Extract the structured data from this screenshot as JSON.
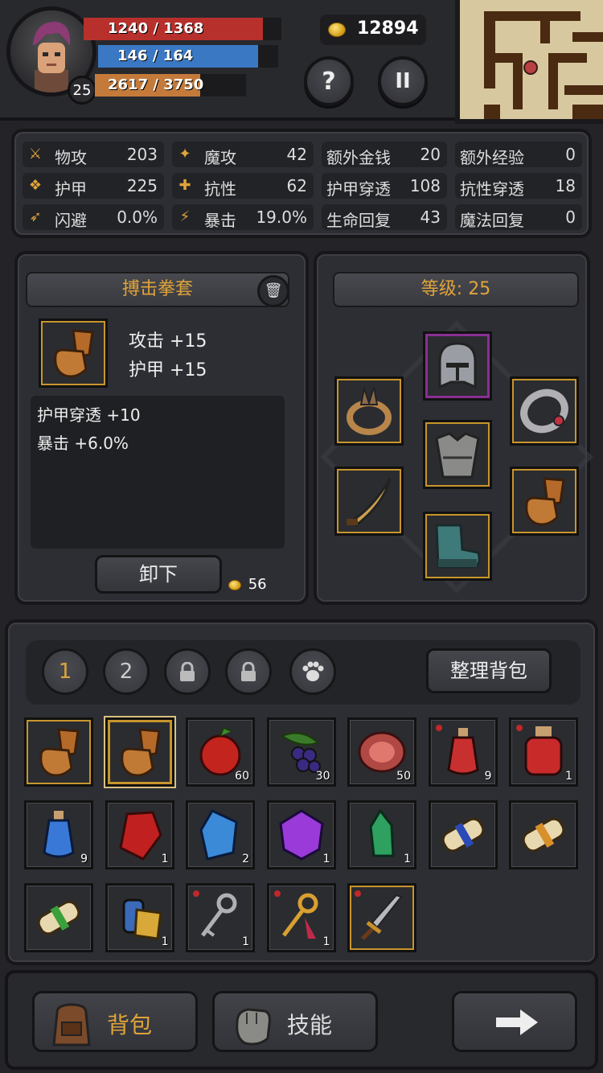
{
  "header": {
    "level": "25",
    "hp_text": "1240 / 1368",
    "hp_fraction": 0.906,
    "mp_text": "146 / 164",
    "mp_fraction": 0.89,
    "exp_text": "2617 / 3750",
    "exp_fraction": 0.698,
    "gold": "12894",
    "help_label": "?",
    "pause_label": "II"
  },
  "stats": [
    {
      "icon": "sword-icon",
      "label": "物攻",
      "value": "203"
    },
    {
      "icon": "magic-icon",
      "label": "魔攻",
      "value": "42"
    },
    {
      "icon": "",
      "label": "额外金钱",
      "value": "20"
    },
    {
      "icon": "",
      "label": "额外经验",
      "value": "0"
    },
    {
      "icon": "paw-icon",
      "label": "护甲",
      "value": "225"
    },
    {
      "icon": "muscle-icon",
      "label": "抗性",
      "value": "62"
    },
    {
      "icon": "",
      "label": "护甲穿透",
      "value": "108"
    },
    {
      "icon": "",
      "label": "抗性穿透",
      "value": "18"
    },
    {
      "icon": "run-icon",
      "label": "闪避",
      "value": "0.0%"
    },
    {
      "icon": "lightning-icon",
      "label": "暴击",
      "value": "19.0%"
    },
    {
      "icon": "",
      "label": "生命回复",
      "value": "43"
    },
    {
      "icon": "",
      "label": "魔法回复",
      "value": "0"
    }
  ],
  "item_detail": {
    "name": "搏击拳套",
    "bonuses": [
      "攻击 +15",
      "护甲 +15"
    ],
    "extra_bonuses": [
      "护甲穿透 +10",
      "暴击 +6.0%"
    ],
    "unequip_label": "卸下",
    "sell_price": "56"
  },
  "equipment": {
    "level_label": "等级: 25"
  },
  "inventory": {
    "tabs": [
      "1",
      "2"
    ],
    "sort_label": "整理背包",
    "items": [
      {
        "name": "gauntlet",
        "count": "",
        "dot": false,
        "border": "gold"
      },
      {
        "name": "gauntlet",
        "count": "",
        "dot": false,
        "border": "gold-selected"
      },
      {
        "name": "apple",
        "count": "60",
        "dot": false,
        "border": "plain"
      },
      {
        "name": "grapes",
        "count": "30",
        "dot": false,
        "border": "plain"
      },
      {
        "name": "meat",
        "count": "50",
        "dot": false,
        "border": "plain"
      },
      {
        "name": "red-potion-small",
        "count": "9",
        "dot": true,
        "border": "plain"
      },
      {
        "name": "red-potion-large",
        "count": "1",
        "dot": true,
        "border": "plain"
      },
      {
        "name": "blue-potion",
        "count": "9",
        "dot": false,
        "border": "plain"
      },
      {
        "name": "red-gem",
        "count": "1",
        "dot": false,
        "border": "plain"
      },
      {
        "name": "blue-gem",
        "count": "2",
        "dot": false,
        "border": "plain"
      },
      {
        "name": "purple-gem",
        "count": "1",
        "dot": false,
        "border": "plain"
      },
      {
        "name": "green-crystal",
        "count": "1",
        "dot": false,
        "border": "plain"
      },
      {
        "name": "blue-scroll",
        "count": "",
        "dot": false,
        "border": "plain"
      },
      {
        "name": "orange-scroll",
        "count": "",
        "dot": false,
        "border": "plain"
      },
      {
        "name": "green-scroll",
        "count": "",
        "dot": false,
        "border": "plain"
      },
      {
        "name": "golden-item",
        "count": "1",
        "dot": false,
        "border": "plain"
      },
      {
        "name": "silver-key",
        "count": "1",
        "dot": true,
        "border": "plain"
      },
      {
        "name": "gold-key",
        "count": "1",
        "dot": true,
        "border": "plain"
      },
      {
        "name": "dagger",
        "count": "",
        "dot": true,
        "border": "gold"
      }
    ]
  },
  "footer": {
    "bag_label": "背包",
    "skill_label": "技能"
  },
  "colors": {
    "hp": "#b8302c",
    "mp": "#3a78c4",
    "exp": "#c47a3a",
    "accent": "#e0a43a"
  }
}
